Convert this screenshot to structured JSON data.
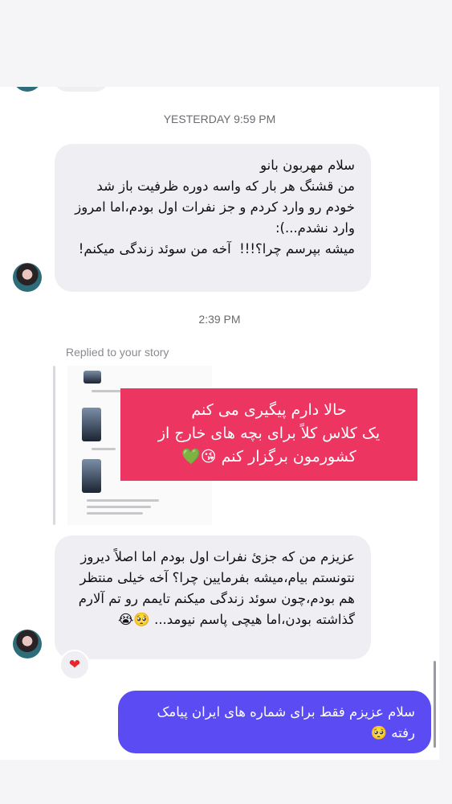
{
  "chat": {
    "timestamp_1": "YESTERDAY 9:59 PM",
    "msg_1": "سلام مهربون بانو\nمن قشنگ هر بار که واسه دوره ظرفیت باز شد خودم رو وارد کردم و جز نفرات اول بودم،اما امروز وارد نشدم...):\nمیشه بپرسم چرا؟!!!  آخه من سوئد زندگی میکنم!",
    "timestamp_2": "2:39 PM",
    "replied_label": "Replied to your story",
    "story_text": "حالا دارم پیگیری می کنم\nیک کلاس کلاً برای بچه های خارج از\nکشورمون برگزار کنم 😘💚",
    "msg_2": "عزیزم من که جزئ نفرات اول بودم اما اصلاً دیروز نتونستم بیام،میشه بفرمایین چرا؟ آخه خیلی منتظر هم بودم،چون سوئد زندگی میکنم تایمم رو تم آلارم گذاشته بودن،اما هیچی پاسم نیومد... 🥺😭",
    "reaction": "❤",
    "msg_3": "سلام عزیزم فقط برای شماره های ایران پیامک رفته 🥺"
  },
  "colors": {
    "sent_bubble": "#5b4bf2",
    "received_bubble": "#efeff3",
    "story_bg": "#ec3560"
  }
}
